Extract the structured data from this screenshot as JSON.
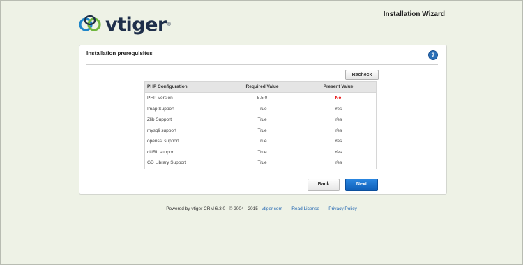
{
  "brand": {
    "name": "vtiger",
    "trademark": "®"
  },
  "header": {
    "wizard_title": "Installation Wizard"
  },
  "panel": {
    "title": "Installation prerequisites",
    "help_icon": "question-mark-icon",
    "recheck_label": "Recheck"
  },
  "table": {
    "columns": [
      "PHP Configuration",
      "Required Value",
      "Present Value"
    ],
    "rows": [
      {
        "config": "PHP Version",
        "required": "5.5.0",
        "present": "No"
      },
      {
        "config": "Imap Support",
        "required": "True",
        "present": "Yes"
      },
      {
        "config": "Zlib Support",
        "required": "True",
        "present": "Yes"
      },
      {
        "config": "mysqli support",
        "required": "True",
        "present": "Yes"
      },
      {
        "config": "openssl support",
        "required": "True",
        "present": "Yes"
      },
      {
        "config": "cURL support",
        "required": "True",
        "present": "Yes"
      },
      {
        "config": "GD Library Support",
        "required": "True",
        "present": "Yes"
      }
    ],
    "failed_color": "#e60000"
  },
  "buttons": {
    "back_label": "Back",
    "next_label": "Next"
  },
  "footer": {
    "powered_by": "Powered by vtiger CRM 6.3.0",
    "copyright": "© 2004 - 2015",
    "site_link": "vtiger.com",
    "separator": "|",
    "license_link": "Read License",
    "privacy_link": "Privacy Policy"
  },
  "colors": {
    "accent": "#1d63b0",
    "next_button": "#1a73d0",
    "background": "#eef2e6"
  }
}
